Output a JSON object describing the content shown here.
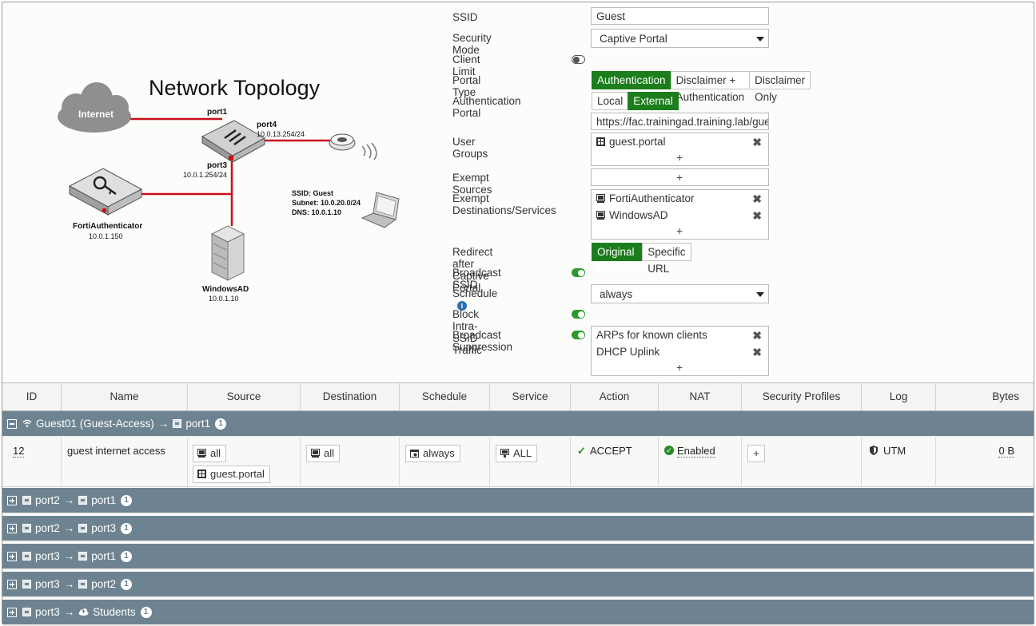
{
  "topology": {
    "title": "Network Topology",
    "internet": "Internet",
    "port1": "port1",
    "port4": "port4",
    "port4_ip": "10.0.13.254/24",
    "port3": "port3",
    "port3_ip": "10.0.1.254/24",
    "fac_name": "FortiAuthenticator",
    "fac_ip": "10.0.1.150",
    "ad_name": "WindowsAD",
    "ad_ip": "10.0.1.10",
    "ssid_line": "SSID:  Guest",
    "subnet_line": "Subnet: 10.0.20.0/24",
    "dns_line": "DNS:  10.0.1.10"
  },
  "form": {
    "ssid_label": "SSID",
    "ssid_value": "Guest",
    "security_mode_label": "Security Mode",
    "security_mode_value": "Captive Portal",
    "client_limit_label": "Client Limit",
    "portal_type_label": "Portal Type",
    "portal_type_options": [
      "Authentication",
      "Disclaimer + Authentication",
      "Disclaimer Only"
    ],
    "auth_portal_label": "Authentication Portal",
    "auth_portal_options": [
      "Local",
      "External"
    ],
    "auth_portal_url": "https://fac.trainingad.training.lab/guest",
    "user_groups_label": "User Groups",
    "user_groups_item": "guest.portal",
    "exempt_sources_label": "Exempt Sources",
    "exempt_dest_label": "Exempt Destinations/Services",
    "exempt_dest_items": [
      "FortiAuthenticator",
      "WindowsAD"
    ],
    "redirect_label": "Redirect after Captive Portal",
    "redirect_options": [
      "Original Request",
      "Specific URL"
    ],
    "broadcast_ssid_label": "Broadcast SSID",
    "schedule_label": "Schedule",
    "schedule_value": "always",
    "block_intra_label": "Block Intra-SSID Traffic",
    "broadcast_suppression_label": "Broadcast Suppression",
    "suppression_items": [
      "ARPs for known clients",
      "DHCP Uplink"
    ],
    "plus": "+"
  },
  "table": {
    "headers": [
      "ID",
      "Name",
      "Source",
      "Destination",
      "Schedule",
      "Service",
      "Action",
      "NAT",
      "Security Profiles",
      "Log",
      "Bytes"
    ],
    "expanded_group": {
      "from": "Guest01 (Guest-Access)",
      "arrow": "→",
      "to": "port1",
      "count": "1"
    },
    "row": {
      "id": "12",
      "name": "guest internet access",
      "source": [
        "all",
        "guest.portal"
      ],
      "destination": "all",
      "schedule": "always",
      "service": "ALL",
      "action": "ACCEPT",
      "nat": "Enabled",
      "profiles_plus": "+",
      "log": "UTM",
      "bytes": "0 B"
    },
    "groups": [
      {
        "from": "port2",
        "arrow": "→",
        "to": "port1",
        "count": "1"
      },
      {
        "from": "port2",
        "arrow": "→",
        "to": "port3",
        "count": "1"
      },
      {
        "from": "port3",
        "arrow": "→",
        "to": "port1",
        "count": "1"
      },
      {
        "from": "port3",
        "arrow": "→",
        "to": "port2",
        "count": "1"
      },
      {
        "from": "port3",
        "arrow": "→",
        "to": "Students",
        "count": "1"
      }
    ]
  }
}
